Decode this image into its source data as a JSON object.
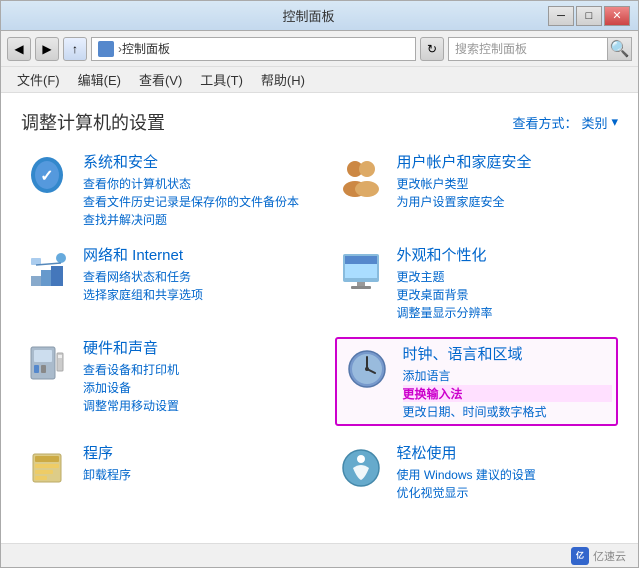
{
  "window": {
    "title": "控制面板",
    "min_btn": "─",
    "max_btn": "□",
    "close_btn": "✕"
  },
  "address_bar": {
    "back": "◀",
    "forward": "▶",
    "up": "↑",
    "path_icon": "■",
    "path": "控制面板",
    "path_separator": "›",
    "refresh": "↻",
    "search_placeholder": "搜索控制面板"
  },
  "menu": {
    "items": [
      "文件(F)",
      "编辑(E)",
      "查看(V)",
      "工具(T)",
      "帮助(H)"
    ]
  },
  "content": {
    "title": "调整计算机的设置",
    "view_label": "查看方式：",
    "view_mode": "类别"
  },
  "categories": [
    {
      "id": "system-security",
      "title": "系统和安全",
      "links": [
        "查看你的计算机状态",
        "查看文件历史记录是保存你的文件备份本",
        "查找并解决问题"
      ]
    },
    {
      "id": "user-accounts",
      "title": "用户帐户和家庭安全",
      "links": [
        "更改帐户类型",
        "为用户设置家庭安全"
      ]
    },
    {
      "id": "network",
      "title": "网络和 Internet",
      "links": [
        "查看网络状态和任务",
        "选择家庭组和共享选项"
      ]
    },
    {
      "id": "appearance",
      "title": "外观和个性化",
      "links": [
        "更改主题",
        "更改桌面背景",
        "调整量显示分辨率"
      ]
    },
    {
      "id": "hardware",
      "title": "硬件和声音",
      "links": [
        "查看设备和打印机",
        "添加设备",
        "调整常用移动设置"
      ]
    },
    {
      "id": "clock",
      "title": "时钟、语言和区域",
      "links": [
        "添加语言",
        "更换输入法",
        "更改日期、时间或数字格式"
      ],
      "highlighted": true,
      "highlight_index": 1
    },
    {
      "id": "programs",
      "title": "程序",
      "links": [
        "卸载程序"
      ]
    },
    {
      "id": "easy-access",
      "title": "轻松使用",
      "links": [
        "使用 Windows 建议的设置",
        "优化视觉显示"
      ]
    }
  ],
  "bottom": {
    "watermark_text": "亿速云",
    "logo_text": "亿"
  }
}
